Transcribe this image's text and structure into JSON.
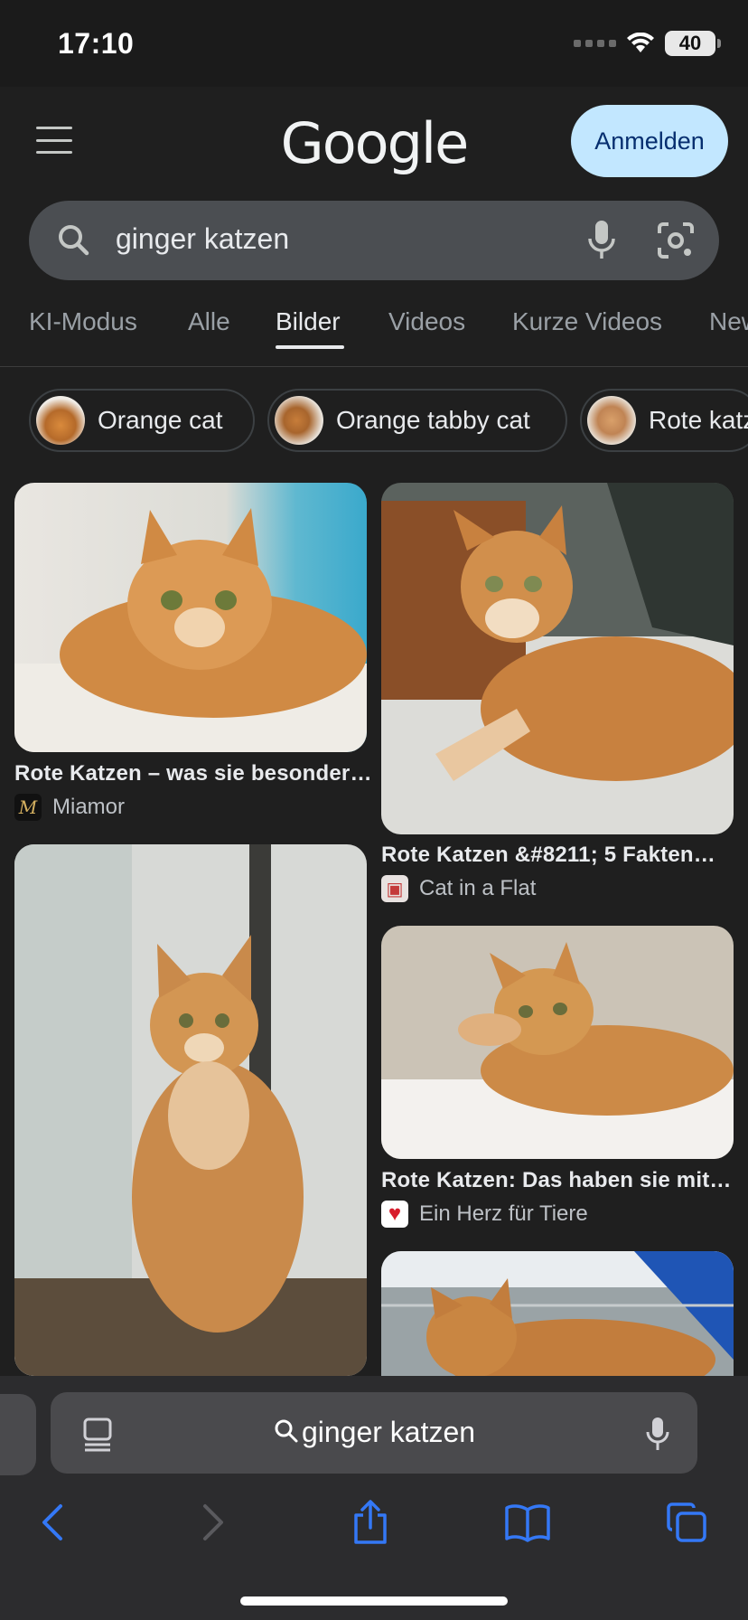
{
  "status_bar": {
    "time": "17:10",
    "battery": "40"
  },
  "header": {
    "logo": "Google",
    "signin_label": "Anmelden",
    "menu_icon": "hamburger-menu-icon"
  },
  "search": {
    "query": "ginger katzen"
  },
  "tabs": [
    {
      "label": "KI-Modus"
    },
    {
      "label": "Alle"
    },
    {
      "label": "Bilder",
      "active": true
    },
    {
      "label": "Videos"
    },
    {
      "label": "Kurze Videos"
    },
    {
      "label": "New"
    }
  ],
  "chips": [
    {
      "label": "Orange cat"
    },
    {
      "label": "Orange tabby cat"
    },
    {
      "label": "Rote katzen"
    }
  ],
  "results": [
    {
      "title": "Rote Katzen – was sie besonder…",
      "source": "Miamor"
    },
    {
      "title": "Rote Katzen &#8211; 5 Fakten…",
      "source": "Cat in a Flat"
    },
    {
      "title": "Rote Katzen: Das haben sie mit…",
      "source": "Ein Herz für Tiere"
    },
    {
      "title": "",
      "source": ""
    },
    {
      "title": "",
      "source": ""
    }
  ],
  "browser": {
    "url_text": "ginger katzen"
  },
  "colors": {
    "background": "#1f1f1f",
    "signin_button": "#c2e7ff",
    "search_box": "#4b4e52",
    "browser_accent": "#3478f6"
  }
}
